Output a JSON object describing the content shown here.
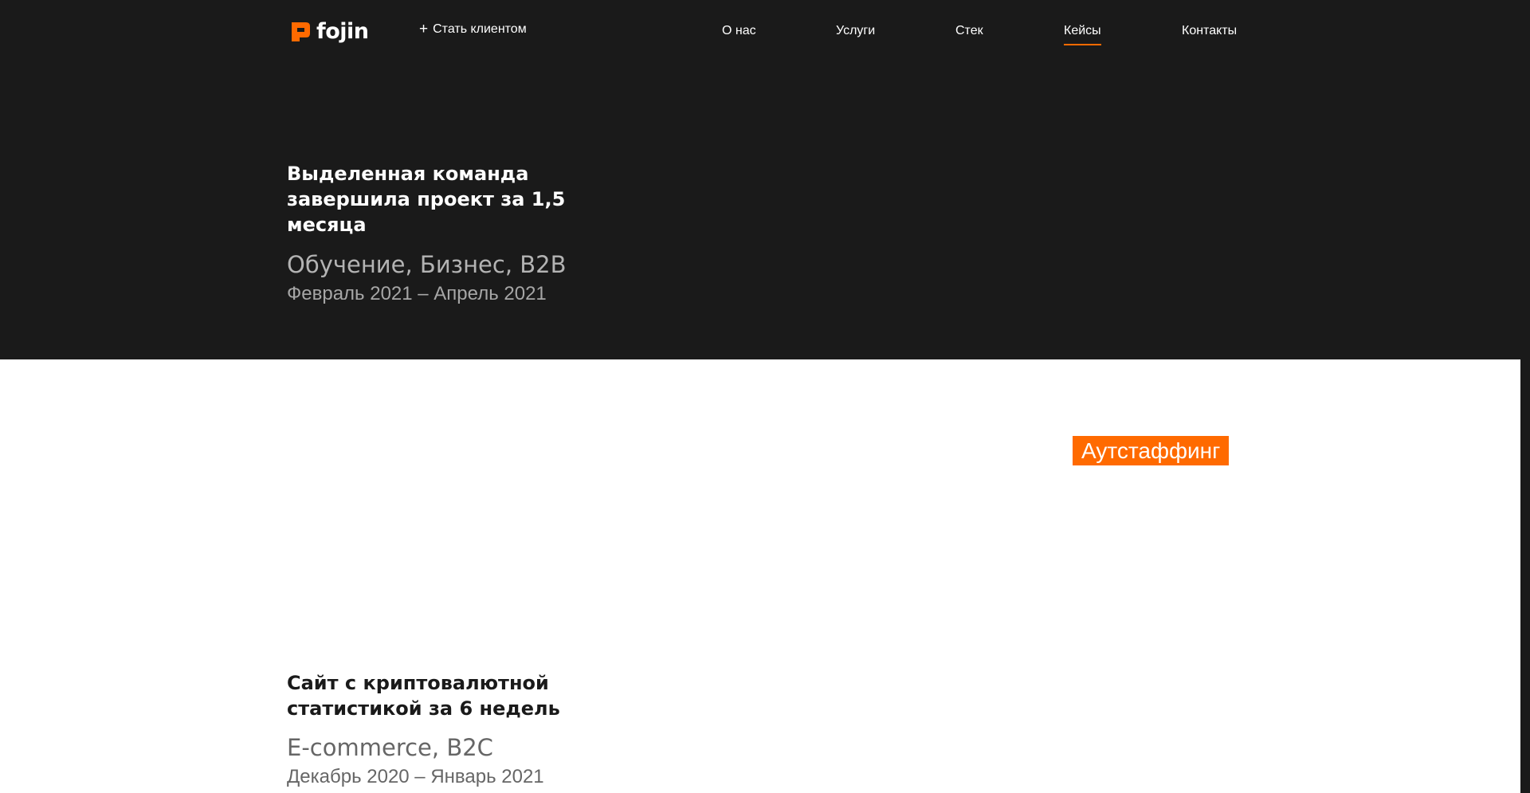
{
  "header": {
    "logo_text": "fojin",
    "logo_icon": "fojin-logo-mark",
    "become_client_label": "Стать клиентом",
    "become_client_icon": "plus-icon",
    "nav": [
      {
        "label": "О нас",
        "active": false
      },
      {
        "label": "Услуги",
        "active": false
      },
      {
        "label": "Стек",
        "active": false
      },
      {
        "label": "Кейсы",
        "active": true
      },
      {
        "label": "Контакты",
        "active": false
      }
    ]
  },
  "cases": [
    {
      "title": "Выделенная команда завершила проект за 1,5 месяца",
      "tags": "Обучение, Бизнес, B2B",
      "dates": "Февраль 2021 – Апрель 2021",
      "badge": ""
    },
    {
      "title": "Сайт с криптовалютной статистикой за 6 недель",
      "tags": "E-commerce, B2C",
      "dates": "Декабрь 2020 – Январь 2021",
      "badge": "Аутстаффинг"
    }
  ],
  "colors": {
    "background_dark": "#1a1a1a",
    "background_light": "#ffffff",
    "accent": "#ff6a00",
    "text_light": "#ffffff",
    "tags_on_dark": "#b3b3b3",
    "dates_on_dark": "#a6a6a6",
    "text_dark": "#1a1a1a",
    "tags_on_light": "#666666",
    "dates_on_light": "#666666"
  }
}
